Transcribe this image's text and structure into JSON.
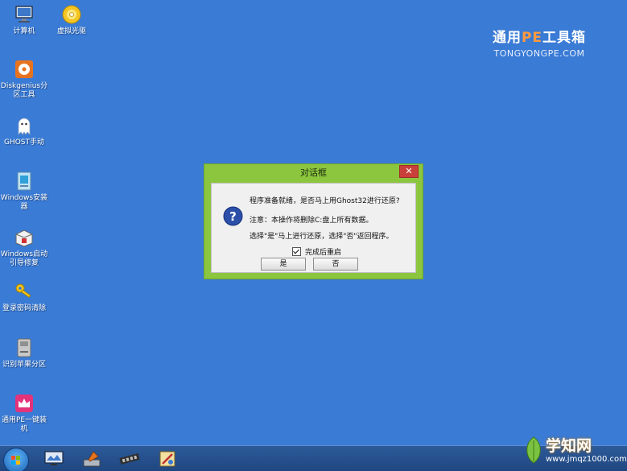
{
  "desktop": {
    "background": "#3a7bd5",
    "icons": [
      {
        "label": "计算机",
        "icon": "computer-icon"
      },
      {
        "label": "虚拟光驱",
        "icon": "virtual-drive-icon"
      },
      {
        "label": "Diskgenius分区工具",
        "icon": "diskgenius-icon"
      },
      {
        "label": "GHOST手动",
        "icon": "ghost-icon"
      },
      {
        "label": "Windows安装器",
        "icon": "windows-installer-icon"
      },
      {
        "label": "Windows启动引导修复",
        "icon": "boot-repair-icon"
      },
      {
        "label": "登录密码清除",
        "icon": "key-icon"
      },
      {
        "label": "识别苹果分区",
        "icon": "apple-partition-icon"
      },
      {
        "label": "通用PE一键装机",
        "icon": "pe-installer-icon"
      }
    ]
  },
  "brand": {
    "title_prefix": "通用",
    "title_pe": "PE",
    "title_suffix": "工具箱",
    "subtitle": "TONGYONGPE.COM"
  },
  "dialog": {
    "title": "对话框",
    "close_label": "✕",
    "message_1": "程序准备就绪，是否马上用Ghost32进行还原?",
    "message_2": "注意：本操作将删除C:盘上所有数据。",
    "message_3": "选择\"是\"马上进行还原，选择\"否\"返回程序。",
    "checkbox_label": "完成后重启",
    "checkbox_checked": true,
    "yes_label": "是",
    "no_label": "否",
    "accent": "#8cc63e"
  },
  "taskbar": {
    "items": [
      "start-orb-icon",
      "monitor-icon",
      "disk-tool-icon",
      "memory-icon",
      "tools-icon"
    ]
  },
  "watermark": {
    "title": "学知网",
    "url": "www.jmqz1000.com"
  }
}
